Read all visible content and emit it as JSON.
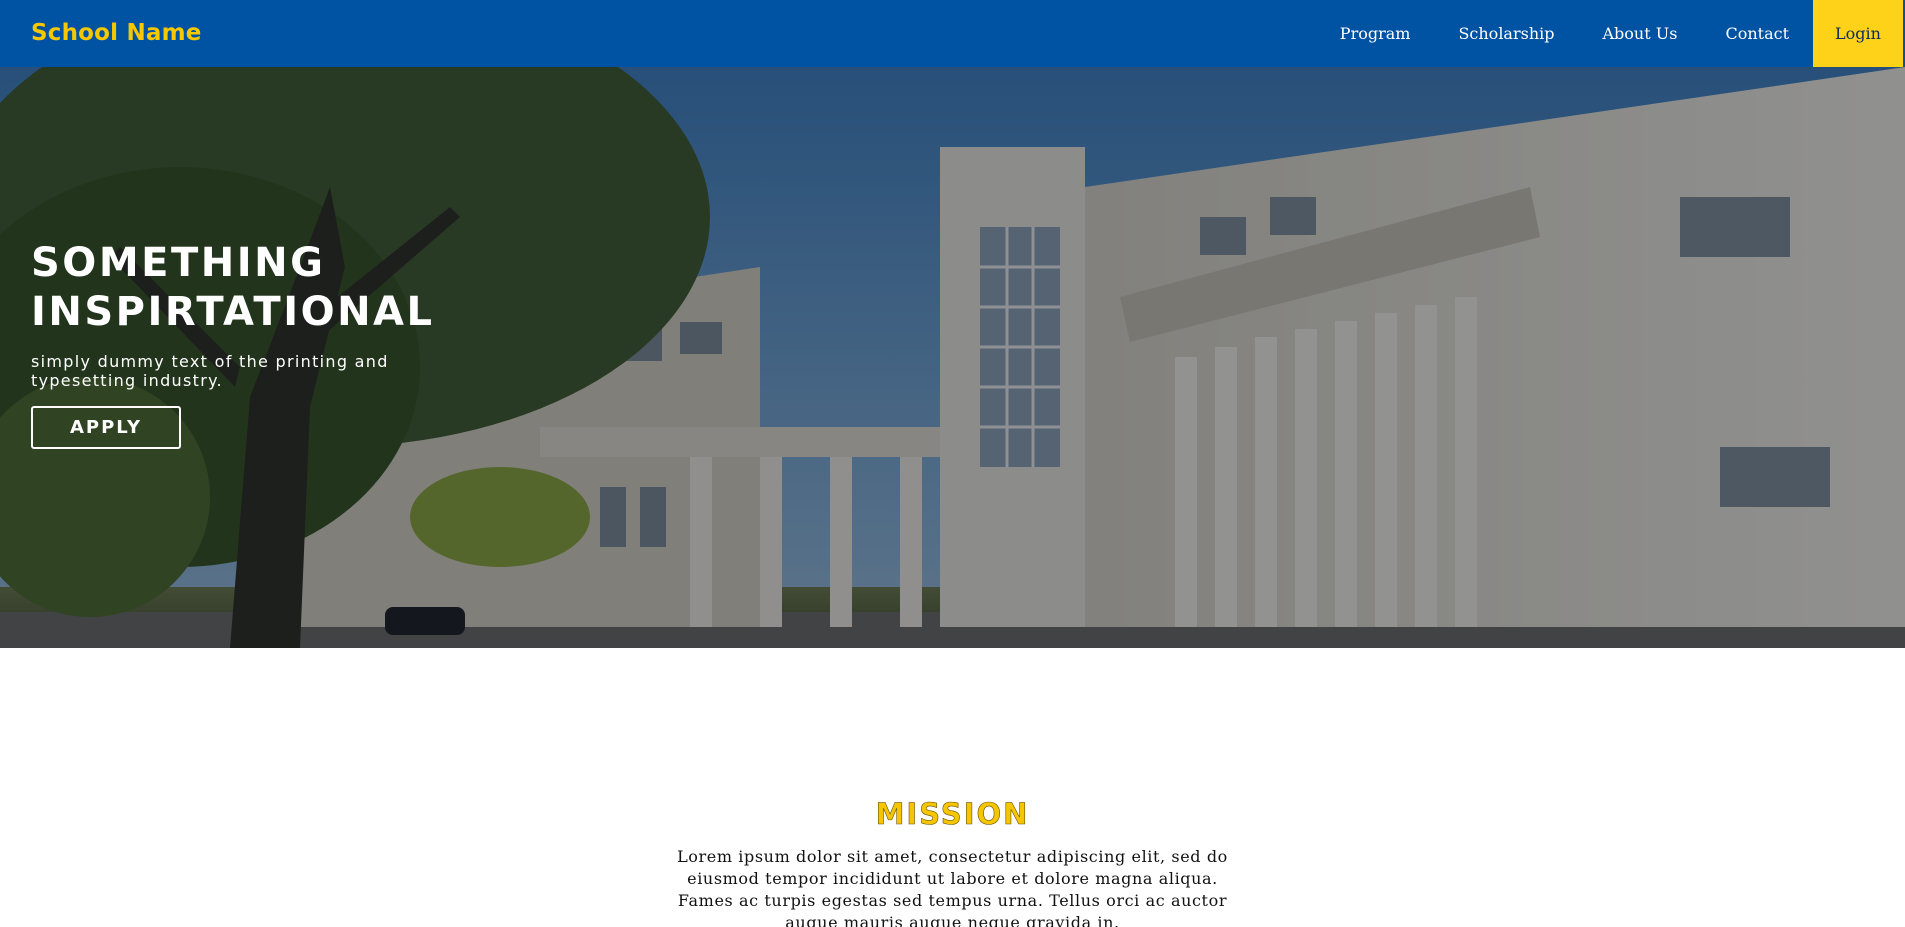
{
  "navbar": {
    "brand": "School Name",
    "links": [
      {
        "label": "Program"
      },
      {
        "label": "Scholarship"
      },
      {
        "label": "About Us"
      },
      {
        "label": "Contact"
      }
    ],
    "login_label": "Login",
    "colors": {
      "background": "#0052a3",
      "brand": "#f7c800",
      "login_bg": "#ffd21a"
    }
  },
  "hero": {
    "title": "SOMETHING INSPIRTATIONAL",
    "subtitle": "simply dummy text of the printing and typesetting industry.",
    "apply_label": "APPLY",
    "image_icon": "campus-building-photo"
  },
  "mission": {
    "title": "MISSION",
    "text": "Lorem ipsum dolor sit amet, consectetur adipiscing elit, sed do eiusmod tempor incididunt ut labore et dolore magna aliqua. Fames ac turpis egestas sed tempus urna. Tellus orci ac auctor augue mauris augue neque gravida in.",
    "title_color": "#f5c500"
  }
}
